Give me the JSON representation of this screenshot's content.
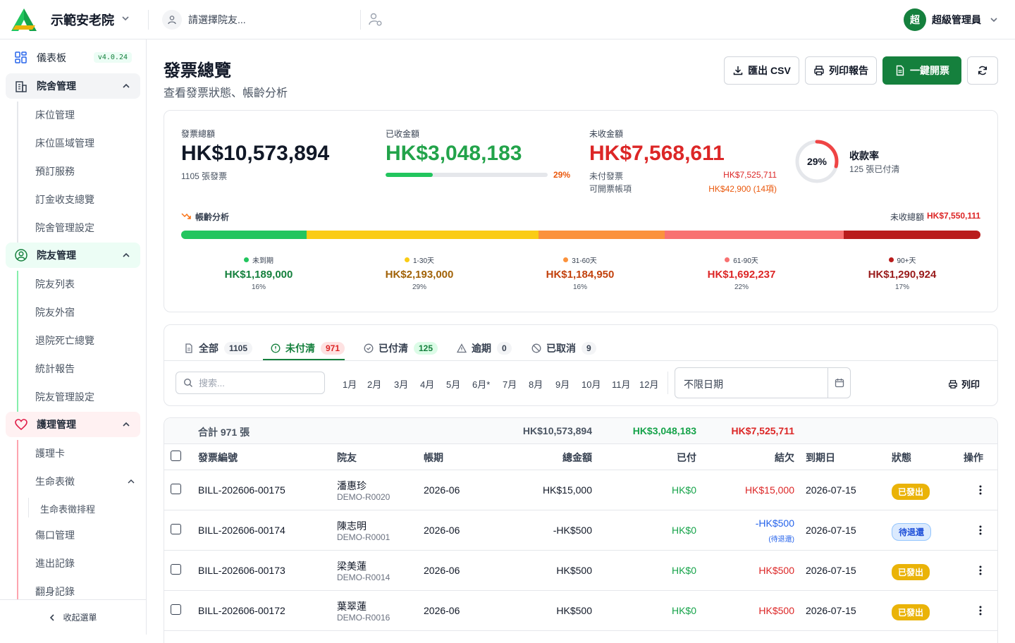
{
  "header": {
    "org_name": "示範安老院",
    "resident_placeholder": "請選擇院友...",
    "avatar_initial": "超",
    "user_name": "超級管理員"
  },
  "sidebar": {
    "dashboard": "儀表板",
    "version": "v4.0.24",
    "groups": [
      {
        "label": "院舍管理",
        "items": [
          "床位管理",
          "床位區域管理",
          "預訂服務",
          "訂金收支總覽",
          "院舍管理設定"
        ]
      },
      {
        "label": "院友管理",
        "items": [
          "院友列表",
          "院友外宿",
          "退院死亡總覽",
          "統計報告",
          "院友管理設定"
        ]
      },
      {
        "label": "護理管理",
        "items": [
          "護理卡",
          "生命表徵",
          "生命表徵排程",
          "傷口管理",
          "進出記錄",
          "翻身記錄"
        ]
      }
    ],
    "collapse": "收起選單"
  },
  "page": {
    "title": "發票總覽",
    "subtitle": "查看發票狀態、帳齡分析",
    "buttons": {
      "export": "匯出 CSV",
      "print_report": "列印報告",
      "one_click": "一鍵開票"
    }
  },
  "summary": {
    "total_label": "發票總額",
    "total_value": "HK$10,573,894",
    "total_sub": "1105 張發票",
    "collected_label": "已收金額",
    "collected_value": "HK$3,048,183",
    "collected_pct": "29%",
    "collected_fraction": 0.29,
    "outstanding_label": "未收金額",
    "outstanding_value": "HK$7,568,611",
    "unpaid_invoices_label": "未付發票",
    "unpaid_invoices_value": "HK$7,525,711",
    "billable_label": "可開票帳項",
    "billable_value": "HK$42,900 (14項)",
    "rate_pct": "29%",
    "rate_fraction": 0.29,
    "rate_label": "收款率",
    "rate_sub": "125 張已付清"
  },
  "aging": {
    "title": "帳齡分析",
    "total_label": "未收總額",
    "total_value": "HK$7,550,111",
    "buckets": [
      {
        "label": "未到期",
        "value": "HK$1,189,000",
        "pct": "16%",
        "share": 0.157,
        "color": "#22c55e",
        "text_color": "#15803d"
      },
      {
        "label": "1-30天",
        "value": "HK$2,193,000",
        "pct": "29%",
        "share": 0.29,
        "color": "#facc15",
        "text_color": "#a16207"
      },
      {
        "label": "31-60天",
        "value": "HK$1,184,950",
        "pct": "16%",
        "share": 0.157,
        "color": "#fb923c",
        "text_color": "#c2410c"
      },
      {
        "label": "61-90天",
        "value": "HK$1,692,237",
        "pct": "22%",
        "share": 0.224,
        "color": "#f87171",
        "text_color": "#dc2626"
      },
      {
        "label": "90+天",
        "value": "HK$1,290,924",
        "pct": "17%",
        "share": 0.171,
        "color": "#b91c1c",
        "text_color": "#991b1b"
      }
    ]
  },
  "tabs": [
    {
      "label": "全部",
      "count": "1105"
    },
    {
      "label": "未付清",
      "count": "971"
    },
    {
      "label": "已付清",
      "count": "125"
    },
    {
      "label": "逾期",
      "count": "0"
    },
    {
      "label": "已取消",
      "count": "9"
    }
  ],
  "filters": {
    "search_placeholder": "搜索...",
    "months": [
      "1月",
      "2月",
      "3月",
      "4月",
      "5月",
      "6月*",
      "7月",
      "8月",
      "9月",
      "10月",
      "11月",
      "12月"
    ],
    "date_placeholder": "不限日期",
    "print": "列印"
  },
  "table": {
    "totals_label": "合計 971 張",
    "totals_amount": "HK$10,573,894",
    "totals_paid": "HK$3,048,183",
    "totals_balance": "HK$7,525,711",
    "headers": {
      "no": "發票編號",
      "resident": "院友",
      "period": "帳期",
      "amount": "總金額",
      "paid": "已付",
      "balance": "結欠",
      "due": "到期日",
      "status": "狀態",
      "action": "操作"
    },
    "rows": [
      {
        "no": "BILL-202606-00175",
        "name": "潘惠珍",
        "rid": "DEMO-R0020",
        "period": "2026-06",
        "amount": "HK$15,000",
        "paid": "HK$0",
        "balance": "HK$15,000",
        "balance_note": "",
        "due": "2026-07-15",
        "status": "已發出"
      },
      {
        "no": "BILL-202606-00174",
        "name": "陳志明",
        "rid": "DEMO-R0001",
        "period": "2026-06",
        "amount": "-HK$500",
        "paid": "HK$0",
        "balance": "-HK$500",
        "balance_note": "(待退還)",
        "due": "2026-07-15",
        "status": "待退還"
      },
      {
        "no": "BILL-202606-00173",
        "name": "梁美蓮",
        "rid": "DEMO-R0014",
        "period": "2026-06",
        "amount": "HK$500",
        "paid": "HK$0",
        "balance": "HK$500",
        "balance_note": "",
        "due": "2026-07-15",
        "status": "已發出"
      },
      {
        "no": "BILL-202606-00172",
        "name": "葉翠蓮",
        "rid": "DEMO-R0016",
        "period": "2026-06",
        "amount": "HK$500",
        "paid": "HK$0",
        "balance": "HK$500",
        "balance_note": "",
        "due": "2026-07-15",
        "status": "已發出"
      }
    ]
  }
}
